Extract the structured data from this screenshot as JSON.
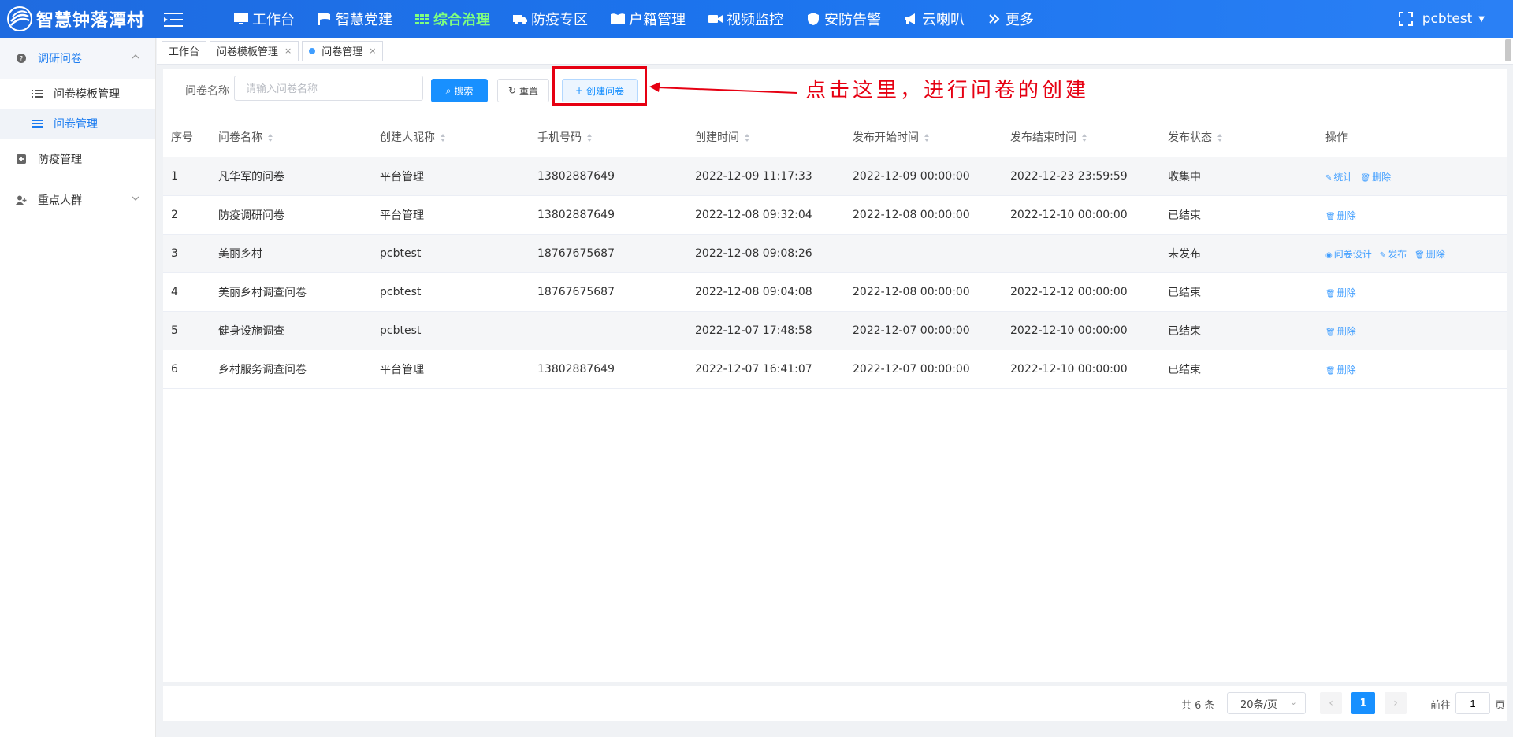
{
  "header": {
    "brand": "智慧钟落潭村",
    "nav": [
      {
        "label": "工作台",
        "icon": "monitor-icon"
      },
      {
        "label": "智慧党建",
        "icon": "flag-icon"
      },
      {
        "label": "综合治理",
        "icon": "grid-icon",
        "active": true
      },
      {
        "label": "防疫专区",
        "icon": "ambulance-icon"
      },
      {
        "label": "户籍管理",
        "icon": "book-icon"
      },
      {
        "label": "视频监控",
        "icon": "video-icon"
      },
      {
        "label": "安防告警",
        "icon": "shield-icon"
      },
      {
        "label": "云喇叭",
        "icon": "megaphone-icon"
      },
      {
        "label": "更多",
        "icon": "double-chevron-icon"
      }
    ],
    "user": "pcbtest",
    "colors": {
      "bar": "#1f6be0",
      "active": "#7fff7f"
    }
  },
  "sidebar": {
    "groups": [
      {
        "label": "调研问卷",
        "icon": "question-circle-icon",
        "open": true,
        "items": [
          {
            "label": "问卷模板管理",
            "icon": "list-icon"
          },
          {
            "label": "问卷管理",
            "icon": "menu-icon",
            "active": true
          }
        ]
      },
      {
        "label": "防疫管理",
        "icon": "plus-square-icon"
      },
      {
        "label": "重点人群",
        "icon": "user-plus-icon"
      }
    ]
  },
  "tabs": [
    {
      "label": "工作台"
    },
    {
      "label": "问卷模板管理",
      "closable": true
    },
    {
      "label": "问卷管理",
      "closable": true,
      "active": true
    }
  ],
  "search": {
    "label": "问卷名称",
    "placeholder": "请输入问卷名称",
    "value": "",
    "search_btn": "搜索",
    "reset_btn": "重置",
    "create_btn": "创建问卷"
  },
  "annotation": {
    "text": "点击这里，进行问卷的创建",
    "color": "#e60012"
  },
  "table": {
    "headers": [
      "序号",
      "问卷名称",
      "创建人昵称",
      "手机号码",
      "创建时间",
      "发布开始时间",
      "发布结束时间",
      "发布状态",
      "操作"
    ],
    "rows": [
      {
        "no": "1",
        "name": "凡华军的问卷",
        "creator": "平台管理",
        "phone": "13802887649",
        "created": "2022-12-09 11:17:33",
        "start": "2022-12-09 00:00:00",
        "end": "2022-12-23 23:59:59",
        "status": "收集中",
        "ops": [
          "统计",
          "删除"
        ]
      },
      {
        "no": "2",
        "name": "防疫调研问卷",
        "creator": "平台管理",
        "phone": "13802887649",
        "created": "2022-12-08 09:32:04",
        "start": "2022-12-08 00:00:00",
        "end": "2022-12-10 00:00:00",
        "status": "已结束",
        "ops": [
          "删除"
        ]
      },
      {
        "no": "3",
        "name": "美丽乡村",
        "creator": "pcbtest",
        "phone": "18767675687",
        "created": "2022-12-08 09:08:26",
        "start": "",
        "end": "",
        "status": "未发布",
        "ops": [
          "问卷设计",
          "发布",
          "删除"
        ]
      },
      {
        "no": "4",
        "name": "美丽乡村调查问卷",
        "creator": "pcbtest",
        "phone": "18767675687",
        "created": "2022-12-08 09:04:08",
        "start": "2022-12-08 00:00:00",
        "end": "2022-12-12 00:00:00",
        "status": "已结束",
        "ops": [
          "删除"
        ]
      },
      {
        "no": "5",
        "name": "健身设施调查",
        "creator": "pcbtest",
        "phone": "",
        "created": "2022-12-07 17:48:58",
        "start": "2022-12-07 00:00:00",
        "end": "2022-12-10 00:00:00",
        "status": "已结束",
        "ops": [
          "删除"
        ]
      },
      {
        "no": "6",
        "name": "乡村服务调查问卷",
        "creator": "平台管理",
        "phone": "13802887649",
        "created": "2022-12-07 16:41:07",
        "start": "2022-12-07 00:00:00",
        "end": "2022-12-10 00:00:00",
        "status": "已结束",
        "ops": [
          "删除"
        ]
      }
    ]
  },
  "pagination": {
    "total": "共 6 条",
    "page_size": "20条/页",
    "current": "1",
    "goto_label": "前往",
    "goto_value": "1",
    "page_suffix": "页"
  }
}
